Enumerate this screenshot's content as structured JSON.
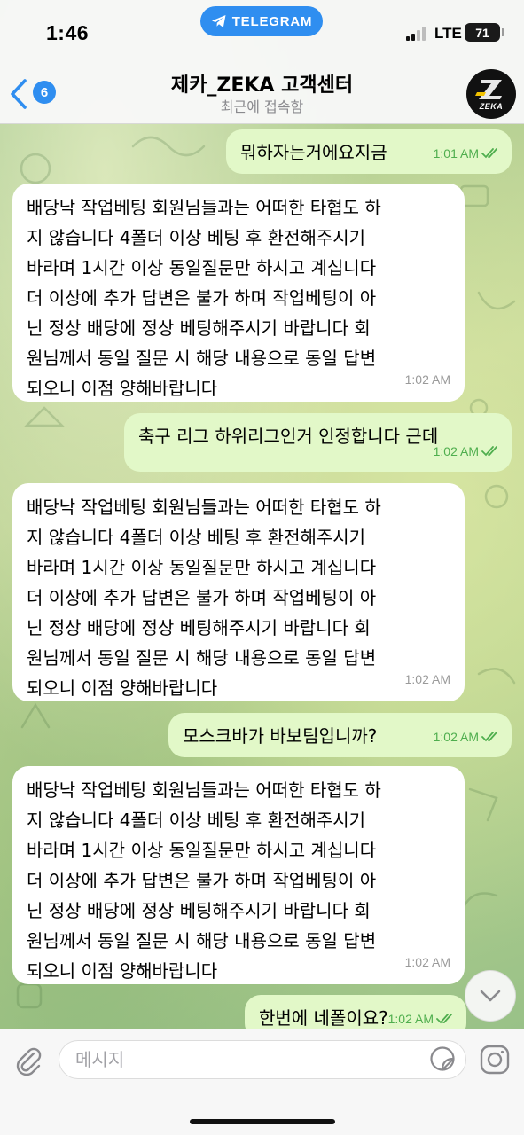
{
  "status_bar": {
    "time": "1:46",
    "app_pill": "TELEGRAM",
    "network": "LTE",
    "battery": "71"
  },
  "header": {
    "back_count": "6",
    "title": "제카_ZEKA 고객센터",
    "subtitle": "최근에 접속함",
    "avatar_label": "ZEKA"
  },
  "messages": [
    {
      "direction": "out",
      "text": "뭐하자는거에요지금",
      "time": "1:01 AM"
    },
    {
      "direction": "in",
      "text": "배당낙 작업베팅 회원님들과는 어떠한 타협도 하\n지 않습니다 4폴더 이상 베팅 후 환전해주시기\n바라며 1시간 이상 동일질문만 하시고 계십니다\n더 이상에 추가 답변은 불가 하며 작업베팅이 아\n닌 정상 배당에 정상 베팅해주시기 바랍니다 회\n원님께서 동일 질문 시 해당 내용으로 동일 답변\n되오니 이점 양해바랍니다",
      "time": "1:02 AM"
    },
    {
      "direction": "out",
      "text": "축구 리그 하위리그인거 인정합니다 근데",
      "time": "1:02 AM"
    },
    {
      "direction": "in",
      "text": "배당낙 작업베팅 회원님들과는 어떠한 타협도 하\n지 않습니다 4폴더 이상 베팅 후 환전해주시기\n바라며 1시간 이상 동일질문만 하시고 계십니다\n더 이상에 추가 답변은 불가 하며 작업베팅이 아\n닌 정상 배당에 정상 베팅해주시기 바랍니다 회\n원님께서 동일 질문 시 해당 내용으로 동일 답변\n되오니 이점 양해바랍니다",
      "time": "1:02 AM"
    },
    {
      "direction": "out",
      "text": "모스크바가 바보팀입니까?",
      "time": "1:02 AM"
    },
    {
      "direction": "in",
      "text": "배당낙 작업베팅 회원님들과는 어떠한 타협도 하\n지 않습니다 4폴더 이상 베팅 후 환전해주시기\n바라며 1시간 이상 동일질문만 하시고 계십니다\n더 이상에 추가 답변은 불가 하며 작업베팅이 아\n닌 정상 배당에 정상 베팅해주시기 바랍니다 회\n원님께서 동일 질문 시 해당 내용으로 동일 답변\n되오니 이점 양해바랍니다",
      "time": "1:02 AM"
    },
    {
      "direction": "out",
      "text": "한번에 네폴이요?",
      "time": "1:02 AM"
    }
  ],
  "input": {
    "placeholder": "메시지"
  },
  "colors": {
    "accent": "#2f8ef0",
    "outgoing_bubble": "#e2f8c8",
    "incoming_bubble": "#ffffff",
    "read_check": "#4fae4e"
  },
  "icons": [
    "telegram-icon",
    "signal-icon",
    "battery-icon",
    "back-chevron-icon",
    "double-check-icon",
    "chevron-down-icon",
    "paperclip-icon",
    "sticker-icon",
    "camera-icon"
  ]
}
